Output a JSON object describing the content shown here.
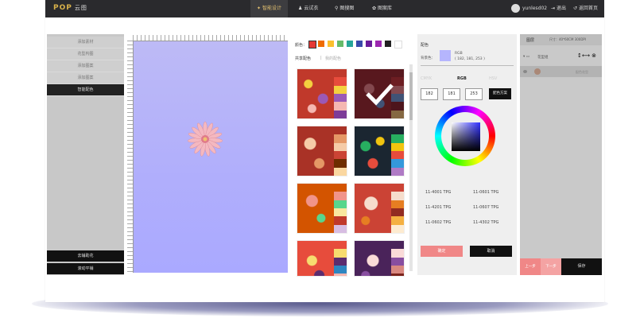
{
  "app": {
    "logo": "POP",
    "logo_sub": "云图"
  },
  "nav": [
    {
      "icon": "magic-icon",
      "label": "智能设计",
      "active": true
    },
    {
      "icon": "shirt-icon",
      "label": "云试衣",
      "active": false
    },
    {
      "icon": "search-icon",
      "label": "图搜图",
      "active": false
    },
    {
      "icon": "gear-icon",
      "label": "图案库",
      "active": false
    }
  ],
  "user": {
    "name": "yunlesd02",
    "logout": "退出",
    "home": "返回首页"
  },
  "sidebar": {
    "items": [
      "添加素材",
      "花型构图",
      "添加图案",
      "添加图案",
      "智能配色"
    ],
    "active_index": 4,
    "bottom": [
      "去辅助花",
      "滚动平铺"
    ]
  },
  "palette": {
    "label": "颜色：",
    "colors": [
      "#e53935",
      "#ef6c00",
      "#fbc02d",
      "#66bb6a",
      "#43a047",
      "#3949ab",
      "#6a1b9a",
      "#9c27b0",
      "#212121",
      "#ffffff"
    ],
    "tab_shared": "共享配色",
    "tab_mine": "我的配色"
  },
  "colorpicker": {
    "title": "配色",
    "swatch_label": "背景色：",
    "rgb_label": "RGB",
    "rgb_value": "( 182, 181, 253 )",
    "modes": [
      "CMYK",
      "RGB",
      "HSV"
    ],
    "active_mode": 1,
    "r": "182",
    "g": "181",
    "b": "253",
    "apply": "配色方案",
    "tpg": [
      "11-4001 TPG",
      "11-0601 TPG",
      "11-4201 TPG",
      "11-0607 TPG",
      "11-0602 TPG",
      "11-4302 TPG"
    ],
    "ok": "确定",
    "cancel": "取消",
    "swatch_color": "#b6b5fd"
  },
  "layers": {
    "title": "图层",
    "size": "尺寸：40*60CM 300DPI",
    "group": "花型组",
    "item": "配色花型",
    "btn_prev": "上一步",
    "btn_next": "下一步",
    "btn_save": "保存"
  }
}
